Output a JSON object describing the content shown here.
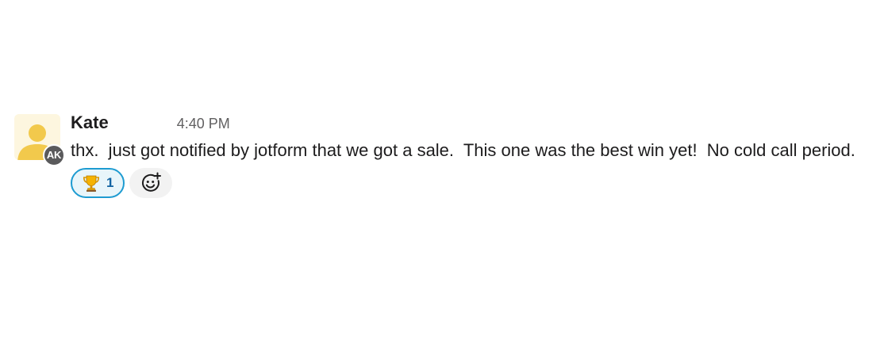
{
  "message": {
    "avatar_initials": "AK",
    "sender": "Kate",
    "timestamp": "4:40 PM",
    "text": "thx.  just got notified by jotform that we got a sale.  This one was the best win yet!  No cold call period.",
    "reactions": [
      {
        "emoji_icon": "trophy-icon",
        "count": "1"
      }
    ],
    "add_reaction_icon": "add-emoji-icon"
  },
  "colors": {
    "avatar_bg": "#fdf6df",
    "avatar_figure": "#f2c94c",
    "reaction_border": "#1d9bd1",
    "reaction_bg": "#e8f5fa",
    "reaction_count": "#1264a3"
  }
}
